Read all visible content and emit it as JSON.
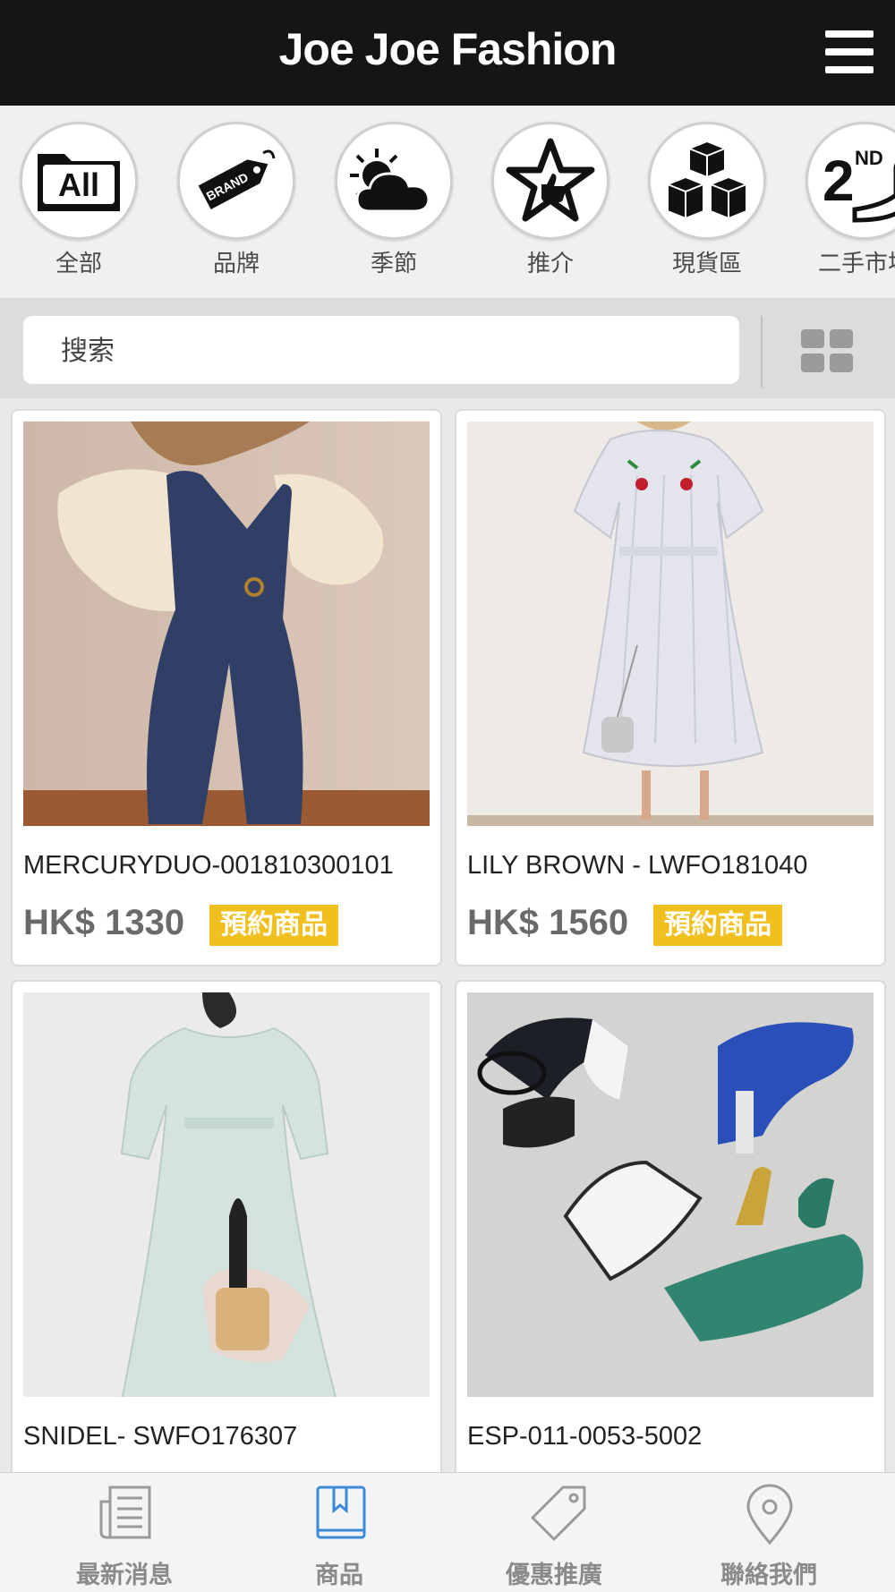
{
  "header": {
    "title": "Joe Joe Fashion"
  },
  "categories": [
    {
      "label": "全部",
      "icon": "all-folder-icon"
    },
    {
      "label": "品牌",
      "icon": "brand-tag-icon"
    },
    {
      "label": "季節",
      "icon": "weather-sun-cloud-icon"
    },
    {
      "label": "推介",
      "icon": "star-thumbs-up-icon"
    },
    {
      "label": "現貨區",
      "icon": "stacked-boxes-icon"
    },
    {
      "label": "二手市場",
      "icon": "2nd-hand-icon"
    }
  ],
  "search": {
    "placeholder": "搜索"
  },
  "products": [
    {
      "name": "MERCURYDUO-001810300101",
      "price": "HK$ 1330",
      "badge": "預約商品",
      "badge_color": "#f0c11e",
      "photo": "woman in navy denim jumpsuit and cream blouse"
    },
    {
      "name": "LILY BROWN - LWFO181040",
      "price": "HK$ 1560",
      "badge": "預約商品",
      "badge_color": "#f0c11e",
      "photo": "woman in striped wrap dress with cherry embroidery"
    },
    {
      "name": "SNIDEL- SWFO176307",
      "price": "",
      "badge": "",
      "badge_color": "#e8305a",
      "photo": "woman in pale mint lace dress holding a basket bag"
    },
    {
      "name": "ESP-011-0053-5002",
      "price": "",
      "badge": "",
      "badge_color": "#e8305a",
      "photo": "pairs of block-heel shoes in black, blue and green"
    }
  ],
  "tabs": [
    {
      "label": "最新消息",
      "icon": "newspaper-icon",
      "active": false
    },
    {
      "label": "商品",
      "icon": "bookmark-book-icon",
      "active": true
    },
    {
      "label": "優惠推廣",
      "icon": "price-tag-icon",
      "active": false
    },
    {
      "label": "聯絡我們",
      "icon": "location-pin-icon",
      "active": false
    }
  ],
  "colors": {
    "header_bg": "#151515",
    "accent_blue": "#3a8ad8",
    "badge_yellow": "#f0c11e",
    "badge_pink": "#e8305a"
  }
}
